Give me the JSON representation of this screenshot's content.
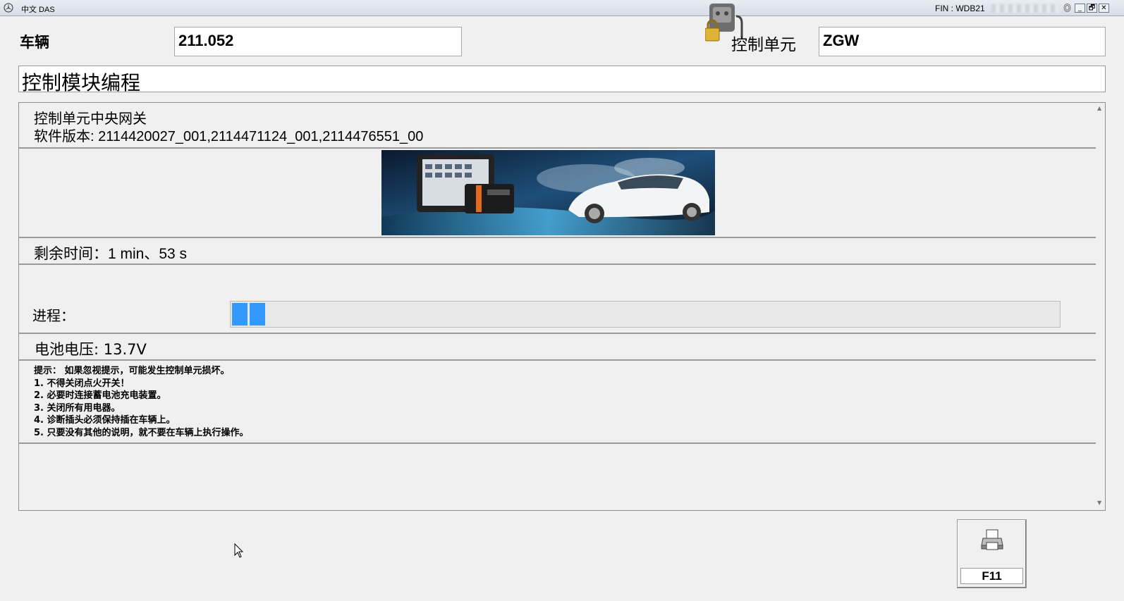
{
  "window": {
    "title": "中文 DAS",
    "fin_label": "FIN : WDB21",
    "controls": {
      "minimize": "_",
      "restore": "🗗",
      "close": "✕"
    }
  },
  "header": {
    "vehicle_label": "车辆",
    "vehicle_value": "211.052",
    "control_unit_label": "控制单元",
    "control_unit_value": "ZGW"
  },
  "module_title": "控制模块编程",
  "panel": {
    "unit_name": "控制单元中央网关",
    "software_version": "软件版本: 2114420027_001,2114471124_001,2114476551_00",
    "remaining_time": "剩余时间：1 min、53 s",
    "progress_label": "进程：",
    "progress_segments": 2,
    "battery_voltage": "电池电压: 13.7V",
    "hints": [
      "提示： 如果忽视提示，可能发生控制单元损坏。",
      "1. 不得关闭点火开关！",
      "2. 必要时连接蓄电池充电装置。",
      "3. 关闭所有用电器。",
      "4. 诊断插头必须保持插在车辆上。",
      "5. 只要没有其他的说明，就不要在车辆上执行操作。"
    ]
  },
  "footer": {
    "f11_label": "F11"
  },
  "colors": {
    "progress": "#3399ff",
    "background": "#f0f0f0"
  },
  "icons": {
    "print": "printer-icon",
    "lock": "lock-icon",
    "logo": "mercedes-star-icon"
  }
}
